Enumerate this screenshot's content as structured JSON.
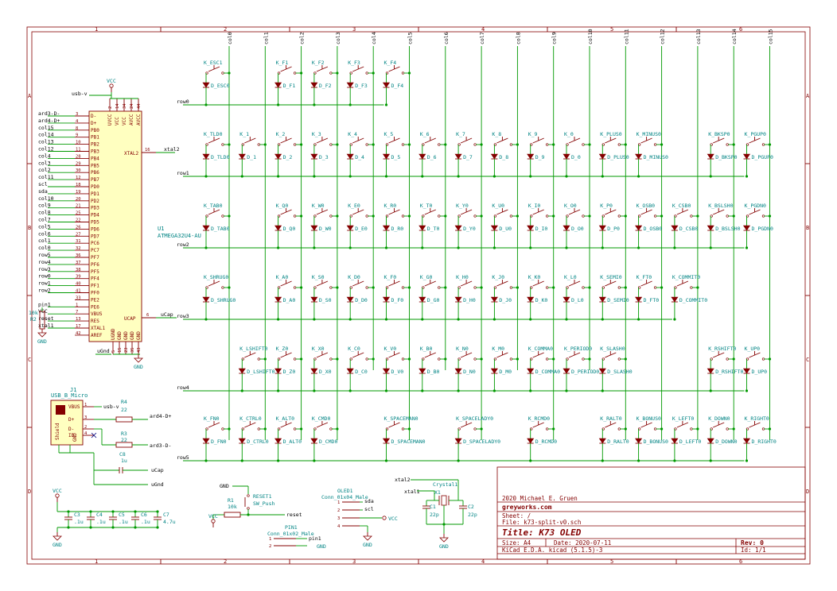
{
  "border": {
    "cols": [
      "1",
      "2",
      "3",
      "4",
      "5",
      "6"
    ],
    "rows": [
      "A",
      "B",
      "C",
      "D"
    ]
  },
  "columns": [
    "col0",
    "col1",
    "col2",
    "col3",
    "col4",
    "col5",
    "col6",
    "col7",
    "col8",
    "col9",
    "col10",
    "col11",
    "col12",
    "col13",
    "col14",
    "col15"
  ],
  "rows": [
    "row0",
    "row1",
    "row2",
    "row3",
    "row4",
    "row5"
  ],
  "matrix": [
    [
      [
        0,
        "K_ESC1",
        "D_ESC0"
      ],
      [
        2,
        "K_F1",
        "D_F1"
      ],
      [
        3,
        "K_F2",
        "D_F2"
      ],
      [
        4,
        "K_F3",
        "D_F3"
      ],
      [
        5,
        "K_F4",
        "D_F4"
      ]
    ],
    [
      [
        0,
        "K_TLD0",
        "D_TLD0"
      ],
      [
        1,
        "K_1",
        "D_1"
      ],
      [
        2,
        "K_2",
        "D_2"
      ],
      [
        3,
        "K_3",
        "D_3"
      ],
      [
        4,
        "K_4",
        "D_4"
      ],
      [
        5,
        "K_5",
        "D_5"
      ],
      [
        6,
        "K_6",
        "D_6"
      ],
      [
        7,
        "K_7",
        "D_7"
      ],
      [
        8,
        "K_8",
        "D_8"
      ],
      [
        9,
        "K_9",
        "D_9"
      ],
      [
        10,
        "K_0",
        "D_0"
      ],
      [
        11,
        "K_PLUS0",
        "D_PLUS0"
      ],
      [
        12,
        "K_MINUS0",
        "D_MINUS0"
      ],
      [
        14,
        "K_BKSP0",
        "D_BKSP0"
      ],
      [
        15,
        "K_PGUP0",
        "D_PGUP0"
      ]
    ],
    [
      [
        0,
        "K_TAB0",
        "D_TAB0"
      ],
      [
        2,
        "K_Q0",
        "D_Q0"
      ],
      [
        3,
        "K_W0",
        "D_W0"
      ],
      [
        4,
        "K_E0",
        "D_E0"
      ],
      [
        5,
        "K_R0",
        "D_R0"
      ],
      [
        6,
        "K_T0",
        "D_T0"
      ],
      [
        7,
        "K_Y0",
        "D_Y0"
      ],
      [
        8,
        "K_U0",
        "D_U0"
      ],
      [
        9,
        "K_I0",
        "D_I0"
      ],
      [
        10,
        "K_O0",
        "D_O0"
      ],
      [
        11,
        "K_P0",
        "D_P0"
      ],
      [
        12,
        "K_OSB0",
        "D_OSB0"
      ],
      [
        13,
        "K_CSB0",
        "D_CSB0"
      ],
      [
        14,
        "K_BSLSH0",
        "D_BSLSH0"
      ],
      [
        15,
        "K_PGDN0",
        "D_PGDN0"
      ]
    ],
    [
      [
        0,
        "K_SHRUG0",
        "D_SHRUG0"
      ],
      [
        2,
        "K_A0",
        "D_A0"
      ],
      [
        3,
        "K_S0",
        "D_S0"
      ],
      [
        4,
        "K_D0",
        "D_D0"
      ],
      [
        5,
        "K_F0",
        "D_F0"
      ],
      [
        6,
        "K_G0",
        "D_G0"
      ],
      [
        7,
        "K_H0",
        "D_H0"
      ],
      [
        8,
        "K_J0",
        "D_J0"
      ],
      [
        9,
        "K_K0",
        "D_K0"
      ],
      [
        10,
        "K_L0",
        "D_L0"
      ],
      [
        11,
        "K_SEMI0",
        "D_SEMI0"
      ],
      [
        12,
        "K_FT0",
        "D_FT0"
      ],
      [
        13,
        "K_COMMIT0",
        "D_COMMIT0"
      ]
    ],
    [
      [
        1,
        "K_LSHIFT0",
        "D_LSHIFT0"
      ],
      [
        2,
        "K_Z0",
        "D_Z0"
      ],
      [
        3,
        "K_X0",
        "D_X0"
      ],
      [
        4,
        "K_C0",
        "D_C0"
      ],
      [
        5,
        "K_V0",
        "D_V0"
      ],
      [
        6,
        "K_B0",
        "D_B0"
      ],
      [
        7,
        "K_N0",
        "D_N0"
      ],
      [
        8,
        "K_M0",
        "D_M0"
      ],
      [
        9,
        "K_COMMA0",
        "D_COMMA0"
      ],
      [
        10,
        "K_PERIOD0",
        "D_PERIOD0"
      ],
      [
        11,
        "K_SLASH0",
        "D_SLASH0"
      ],
      [
        14,
        "K_RSHIFT0",
        "D_RSHIFT0"
      ],
      [
        15,
        "K_UP0",
        "D_UP0"
      ]
    ],
    [
      [
        0,
        "K_FN0",
        "D_FN0"
      ],
      [
        1,
        "K_CTRL0",
        "D_CTRL0"
      ],
      [
        2,
        "K_ALT0",
        "D_ALT0"
      ],
      [
        3,
        "K_CMD0",
        "D_CMD0"
      ],
      [
        5,
        "K_SPACEMAN0",
        "D_SPACEMAN0"
      ],
      [
        7,
        "K_SPACELADY0",
        "D_SPACELADY0"
      ],
      [
        9,
        "K_RCMD0",
        "D_RCMD0"
      ],
      [
        11,
        "K_RALT0",
        "D_RALT0"
      ],
      [
        12,
        "K_BONUS0",
        "D_BONUS0"
      ],
      [
        13,
        "K_LEFT0",
        "D_LEFT0"
      ],
      [
        14,
        "K_DOWN0",
        "D_DOWN0"
      ],
      [
        15,
        "K_RIGHT0",
        "D_RIGHT0"
      ]
    ]
  ],
  "mcu": {
    "ref": "U1",
    "value": "ATMEGA32U4-AU",
    "vcc_label": "VCC",
    "usb_net": "usb-v",
    "ugnd": "uGnd",
    "gnd": "GND",
    "left_pins": [
      [
        "ard3-D-",
        "3",
        "D-"
      ],
      [
        "ard4-D+",
        "4",
        "D+"
      ],
      [
        "col15",
        "8",
        "PB0"
      ],
      [
        "col14",
        "9",
        "PB1"
      ],
      [
        "col13",
        "10",
        "PB2"
      ],
      [
        "col12",
        "11",
        "PB3"
      ],
      [
        "col4",
        "28",
        "PB4"
      ],
      [
        "col3",
        "29",
        "PB5"
      ],
      [
        "col2",
        "30",
        "PB6"
      ],
      [
        "col11",
        "12",
        "PB7"
      ],
      [
        "scl",
        "18",
        "PD0"
      ],
      [
        "sda",
        "19",
        "PD1"
      ],
      [
        "col10",
        "20",
        "PD2"
      ],
      [
        "col9",
        "21",
        "PD3"
      ],
      [
        "col8",
        "25",
        "PD4"
      ],
      [
        "col7",
        "22",
        "PD5"
      ],
      [
        "col5",
        "26",
        "PD6"
      ],
      [
        "col6",
        "27",
        "PD7"
      ],
      [
        "col1",
        "31",
        "PC6"
      ],
      [
        "col0",
        "32",
        "PC7"
      ],
      [
        "row5",
        "36",
        "PF7"
      ],
      [
        "row4",
        "37",
        "PF6"
      ],
      [
        "row3",
        "38",
        "PF5"
      ],
      [
        "row0",
        "39",
        "PF4"
      ],
      [
        "row1",
        "40",
        "PF1"
      ],
      [
        "row2",
        "41",
        "PF0"
      ],
      [
        "",
        "33",
        "PE2"
      ],
      [
        "pin1",
        "1",
        "PE6"
      ],
      [
        "VCC",
        "7",
        "VBUS"
      ],
      [
        "reset",
        "13",
        "RES"
      ],
      [
        "xtal1",
        "17",
        "XTAL1"
      ],
      [
        "",
        "42",
        "AREF"
      ]
    ],
    "top_pins": [
      [
        "2",
        "UVCC"
      ],
      [
        "14",
        "VCC"
      ],
      [
        "34",
        "VCC"
      ],
      [
        "24",
        "AVCC"
      ],
      [
        "44",
        "AVCC"
      ]
    ],
    "bottom_pins": [
      [
        "5",
        "UGND"
      ],
      [
        "15",
        "GND"
      ],
      [
        "23",
        "GND"
      ],
      [
        "35",
        "GND"
      ],
      [
        "43",
        "GND"
      ]
    ],
    "xtal2": [
      "16",
      "XTAL2",
      "xtal2"
    ],
    "ucap": [
      "6",
      "UCAP",
      "uCap"
    ]
  },
  "r2": {
    "ref": "R2",
    "value": "10k"
  },
  "usb": {
    "ref": "J1",
    "value": "USB_B_Micro",
    "pins": [
      [
        "1",
        "VBUS",
        "usb-v"
      ],
      [
        "3",
        "D+",
        ""
      ],
      [
        "2",
        "D-",
        ""
      ],
      [
        "4",
        "ID",
        ""
      ],
      [
        "6",
        "Shield",
        ""
      ],
      [
        "5",
        "GND",
        ""
      ]
    ],
    "r4": {
      "ref": "R4",
      "value": "22",
      "net": "ard4-D+"
    },
    "r3": {
      "ref": "R3",
      "value": "22",
      "net": "ard3-D-"
    },
    "c8": {
      "ref": "C8",
      "value": "1u"
    },
    "ucap": "uCap",
    "ugnd": "uGnd"
  },
  "caps": {
    "vcc": "VCC",
    "gnd": "GND",
    "items": [
      [
        "C3",
        ".1u"
      ],
      [
        "C4",
        ".1u"
      ],
      [
        "C5",
        ".1u"
      ],
      [
        "C6",
        ".1u"
      ],
      [
        "C7",
        "4.7u"
      ]
    ]
  },
  "reset": {
    "gnd": "GND",
    "sw_ref": "RESET1",
    "sw_value": "SW_Push",
    "r_ref": "R1",
    "r_value": "10k",
    "vcc": "VCC",
    "net": "reset"
  },
  "pin1": {
    "ref": "PIN1",
    "value": "Conn_01x02_Male",
    "net": "pin1",
    "pins": [
      "1",
      "2"
    ],
    "gnd": "GND"
  },
  "oled": {
    "ref": "OLED1",
    "value": "Conn_01x04_Male",
    "nets": [
      "sda",
      "scl",
      "VCC",
      "GND"
    ],
    "pins": [
      "1",
      "2",
      "3",
      "4"
    ]
  },
  "crystal": {
    "xtal2": "xtal2",
    "xtal1": "xtal1",
    "ref": "Crystal1",
    "x_ref": "X1",
    "c1": [
      "C1",
      "22p"
    ],
    "c2": [
      "C2",
      "22p"
    ],
    "gnd": "GND"
  },
  "title_block": {
    "author": "2020 Michael E. Gruen",
    "company": "greyworks.com",
    "sheet": "Sheet: /",
    "file": "File: k73-split-v0.sch",
    "title": "Title: K73 OLED",
    "size": "Size: A4",
    "date": "Date: 2020-07-11",
    "rev": "Rev: 0",
    "tool": "KiCad E.D.A.  kicad (5.1.5)-3",
    "id": "Id: 1/1"
  },
  "colors": {
    "wire": "#009900",
    "component": "#840000",
    "text": "#008484",
    "net": "#000000"
  }
}
